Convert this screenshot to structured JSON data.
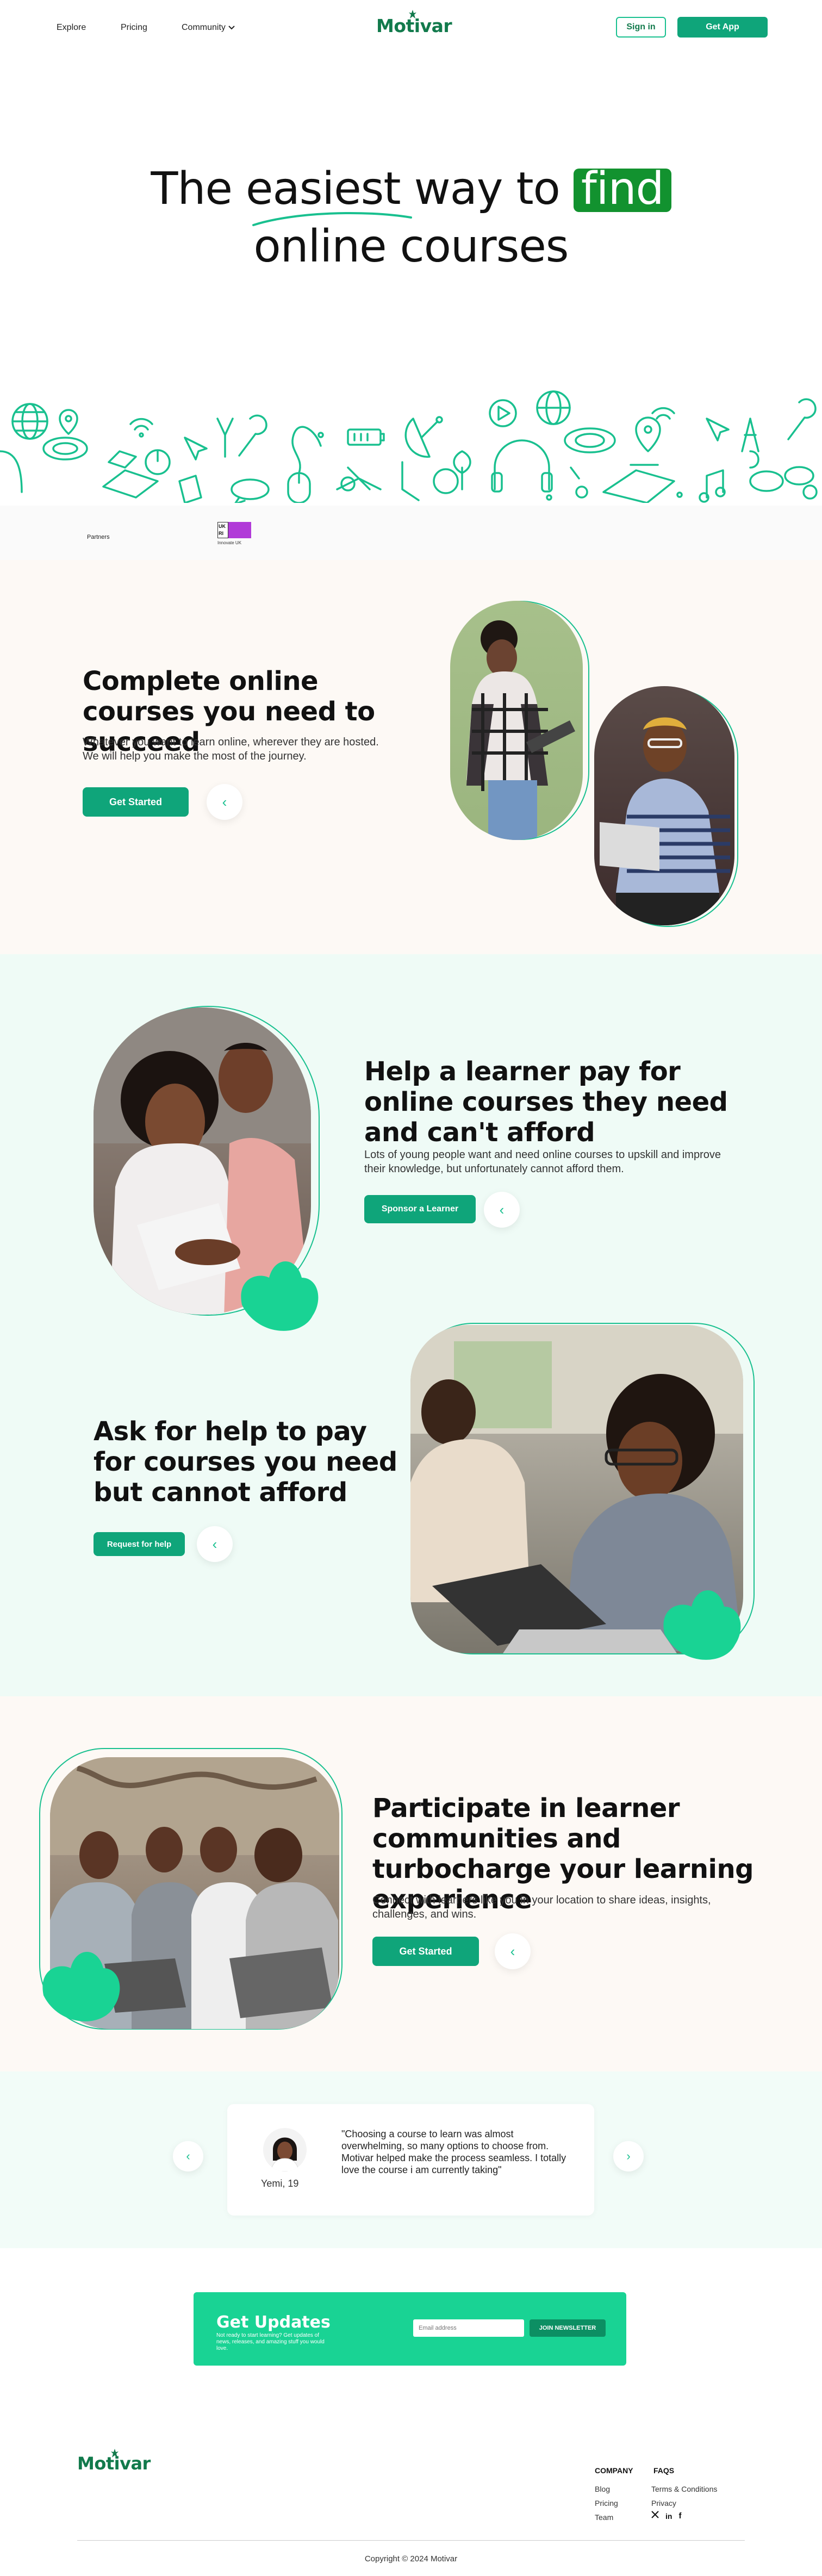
{
  "nav": {
    "links": [
      {
        "label": "Explore"
      },
      {
        "label": "Pricing"
      },
      {
        "label": "Community"
      }
    ],
    "logo": "Motivar",
    "sign_in": "Sign in",
    "get_app": "Get App"
  },
  "hero": {
    "line1_a": "The",
    "line1_b": "easiest",
    "line1_c": "way to",
    "line1_highlight": "find",
    "line2": "online courses"
  },
  "partners": {
    "label": "Partners",
    "logo_text": "Innovate UK",
    "logo_mark": "UK RI"
  },
  "section1": {
    "title": "Complete online courses you need to succeed",
    "body": "Whatever you want to learn online, wherever they are hosted. We will help you make the most of the journey.",
    "cta": "Get Started"
  },
  "section2": {
    "title": "Help a learner pay for online courses they need and can't afford",
    "body": "Lots of young people want and need online courses to upskill and improve their knowledge, but unfortunately cannot afford them.",
    "cta": "Sponsor a Learner"
  },
  "section3": {
    "title": "Ask for help to pay for courses you need but cannot afford",
    "cta": "Request for help"
  },
  "section4": {
    "title": "Participate in learner communities and turbocharge your learning experience",
    "body": "Connect with learners like you in your location to share ideas, insights, challenges, and wins.",
    "cta": "Get Started"
  },
  "testimonial": {
    "quote": "\"Choosing a course to learn was almost overwhelming, so many options to choose from. Motivar helped make the process seamless. I totally love the course i am currently taking\"",
    "author": "Yemi, 19"
  },
  "updates": {
    "title": "Get Updates",
    "body": "Not ready to start learning? Get updates of news, releases, and amazing stuff you would love.",
    "placeholder": "Email address",
    "button": "JOIN NEWSLETTER"
  },
  "footer": {
    "logo": "Motivar",
    "company_heading": "COMPANY",
    "company_links": [
      "Blog",
      "Pricing",
      "Team"
    ],
    "faqs_heading": "FAQS",
    "faqs_links": [
      "Terms & Conditions",
      "Privacy"
    ],
    "social": [
      "x-icon",
      "linkedin-icon",
      "facebook-icon"
    ],
    "copyright": "Copyright © 2024 Motivar"
  },
  "colors": {
    "brand_dark": "#127a4c",
    "brand": "#0fa57a",
    "accent": "#19c08f",
    "highlight": "#12922f",
    "mint_bg": "#effbf6",
    "cream_bg": "#fdf9f5",
    "updates_bg": "#19d394"
  }
}
